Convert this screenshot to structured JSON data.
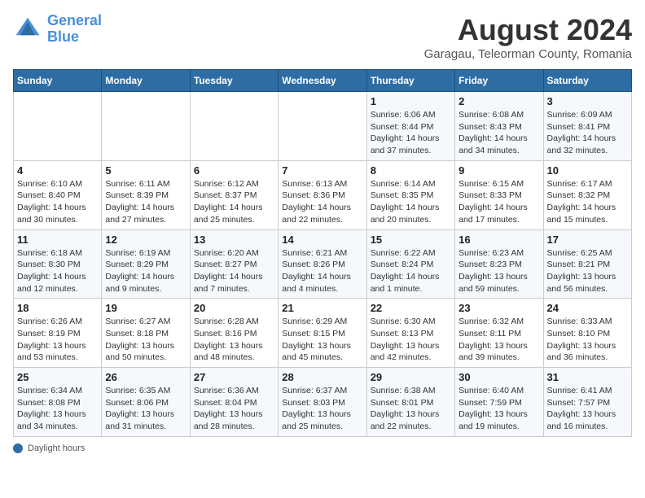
{
  "header": {
    "logo_line1": "General",
    "logo_line2": "Blue",
    "main_title": "August 2024",
    "subtitle": "Garagau, Teleorman County, Romania"
  },
  "weekdays": [
    "Sunday",
    "Monday",
    "Tuesday",
    "Wednesday",
    "Thursday",
    "Friday",
    "Saturday"
  ],
  "weeks": [
    [
      {
        "day": "",
        "info": ""
      },
      {
        "day": "",
        "info": ""
      },
      {
        "day": "",
        "info": ""
      },
      {
        "day": "",
        "info": ""
      },
      {
        "day": "1",
        "info": "Sunrise: 6:06 AM\nSunset: 8:44 PM\nDaylight: 14 hours\nand 37 minutes."
      },
      {
        "day": "2",
        "info": "Sunrise: 6:08 AM\nSunset: 8:43 PM\nDaylight: 14 hours\nand 34 minutes."
      },
      {
        "day": "3",
        "info": "Sunrise: 6:09 AM\nSunset: 8:41 PM\nDaylight: 14 hours\nand 32 minutes."
      }
    ],
    [
      {
        "day": "4",
        "info": "Sunrise: 6:10 AM\nSunset: 8:40 PM\nDaylight: 14 hours\nand 30 minutes."
      },
      {
        "day": "5",
        "info": "Sunrise: 6:11 AM\nSunset: 8:39 PM\nDaylight: 14 hours\nand 27 minutes."
      },
      {
        "day": "6",
        "info": "Sunrise: 6:12 AM\nSunset: 8:37 PM\nDaylight: 14 hours\nand 25 minutes."
      },
      {
        "day": "7",
        "info": "Sunrise: 6:13 AM\nSunset: 8:36 PM\nDaylight: 14 hours\nand 22 minutes."
      },
      {
        "day": "8",
        "info": "Sunrise: 6:14 AM\nSunset: 8:35 PM\nDaylight: 14 hours\nand 20 minutes."
      },
      {
        "day": "9",
        "info": "Sunrise: 6:15 AM\nSunset: 8:33 PM\nDaylight: 14 hours\nand 17 minutes."
      },
      {
        "day": "10",
        "info": "Sunrise: 6:17 AM\nSunset: 8:32 PM\nDaylight: 14 hours\nand 15 minutes."
      }
    ],
    [
      {
        "day": "11",
        "info": "Sunrise: 6:18 AM\nSunset: 8:30 PM\nDaylight: 14 hours\nand 12 minutes."
      },
      {
        "day": "12",
        "info": "Sunrise: 6:19 AM\nSunset: 8:29 PM\nDaylight: 14 hours\nand 9 minutes."
      },
      {
        "day": "13",
        "info": "Sunrise: 6:20 AM\nSunset: 8:27 PM\nDaylight: 14 hours\nand 7 minutes."
      },
      {
        "day": "14",
        "info": "Sunrise: 6:21 AM\nSunset: 8:26 PM\nDaylight: 14 hours\nand 4 minutes."
      },
      {
        "day": "15",
        "info": "Sunrise: 6:22 AM\nSunset: 8:24 PM\nDaylight: 14 hours\nand 1 minute."
      },
      {
        "day": "16",
        "info": "Sunrise: 6:23 AM\nSunset: 8:23 PM\nDaylight: 13 hours\nand 59 minutes."
      },
      {
        "day": "17",
        "info": "Sunrise: 6:25 AM\nSunset: 8:21 PM\nDaylight: 13 hours\nand 56 minutes."
      }
    ],
    [
      {
        "day": "18",
        "info": "Sunrise: 6:26 AM\nSunset: 8:19 PM\nDaylight: 13 hours\nand 53 minutes."
      },
      {
        "day": "19",
        "info": "Sunrise: 6:27 AM\nSunset: 8:18 PM\nDaylight: 13 hours\nand 50 minutes."
      },
      {
        "day": "20",
        "info": "Sunrise: 6:28 AM\nSunset: 8:16 PM\nDaylight: 13 hours\nand 48 minutes."
      },
      {
        "day": "21",
        "info": "Sunrise: 6:29 AM\nSunset: 8:15 PM\nDaylight: 13 hours\nand 45 minutes."
      },
      {
        "day": "22",
        "info": "Sunrise: 6:30 AM\nSunset: 8:13 PM\nDaylight: 13 hours\nand 42 minutes."
      },
      {
        "day": "23",
        "info": "Sunrise: 6:32 AM\nSunset: 8:11 PM\nDaylight: 13 hours\nand 39 minutes."
      },
      {
        "day": "24",
        "info": "Sunrise: 6:33 AM\nSunset: 8:10 PM\nDaylight: 13 hours\nand 36 minutes."
      }
    ],
    [
      {
        "day": "25",
        "info": "Sunrise: 6:34 AM\nSunset: 8:08 PM\nDaylight: 13 hours\nand 34 minutes."
      },
      {
        "day": "26",
        "info": "Sunrise: 6:35 AM\nSunset: 8:06 PM\nDaylight: 13 hours\nand 31 minutes."
      },
      {
        "day": "27",
        "info": "Sunrise: 6:36 AM\nSunset: 8:04 PM\nDaylight: 13 hours\nand 28 minutes."
      },
      {
        "day": "28",
        "info": "Sunrise: 6:37 AM\nSunset: 8:03 PM\nDaylight: 13 hours\nand 25 minutes."
      },
      {
        "day": "29",
        "info": "Sunrise: 6:38 AM\nSunset: 8:01 PM\nDaylight: 13 hours\nand 22 minutes."
      },
      {
        "day": "30",
        "info": "Sunrise: 6:40 AM\nSunset: 7:59 PM\nDaylight: 13 hours\nand 19 minutes."
      },
      {
        "day": "31",
        "info": "Sunrise: 6:41 AM\nSunset: 7:57 PM\nDaylight: 13 hours\nand 16 minutes."
      }
    ]
  ],
  "footer": {
    "daylight_label": "Daylight hours"
  }
}
